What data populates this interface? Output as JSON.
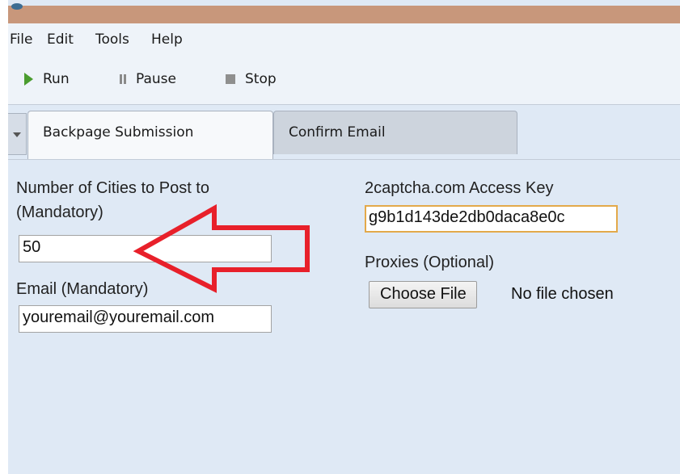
{
  "menu": {
    "items": [
      "File",
      "Edit",
      "Tools",
      "Help"
    ]
  },
  "toolbar": {
    "run": "Run",
    "pause": "Pause",
    "stop": "Stop"
  },
  "tabs": [
    {
      "label": "Backpage Submission",
      "active": true
    },
    {
      "label": "Confirm Email",
      "active": false
    }
  ],
  "form": {
    "cities_label_line1": "Number of Cities to Post to",
    "cities_label_line2": "(Mandatory)",
    "cities_value": "50",
    "email_label": "Email (Mandatory)",
    "email_value": "youremail@youremail.com",
    "captcha_label": "2captcha.com Access Key",
    "captcha_value": "g9b1d143de2db0daca8e0c",
    "proxies_label": "Proxies (Optional)",
    "choose_file_label": "Choose File",
    "no_file_text": "No file chosen"
  },
  "colors": {
    "annotation_arrow": "#e8202a",
    "run_icon": "#4a9c2f",
    "focus_border": "#e3a94a"
  }
}
